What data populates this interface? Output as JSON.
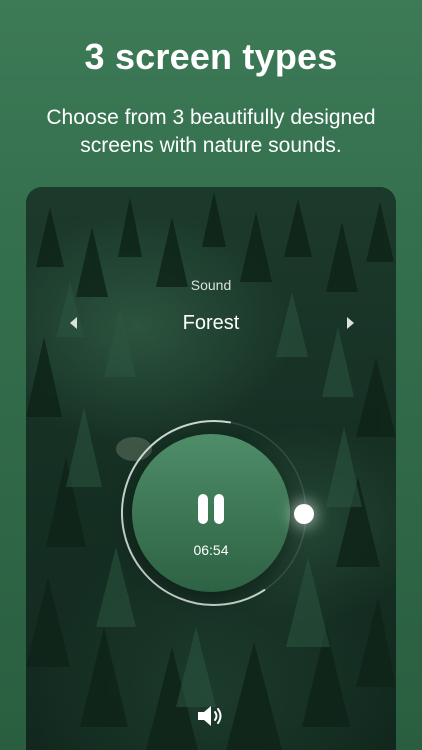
{
  "headline": "3 screen types",
  "subheadline": "Choose from 3 beautifully designed screens with nature sounds.",
  "player": {
    "sound_label": "Sound",
    "sound_name": "Forest",
    "timer": "06:54",
    "progress_fraction": 0.62,
    "accent_color": "#3a7352"
  },
  "icons": {
    "prev": "chevron-left-icon",
    "next": "chevron-right-icon",
    "play_state": "pause-icon",
    "volume": "volume-icon"
  }
}
